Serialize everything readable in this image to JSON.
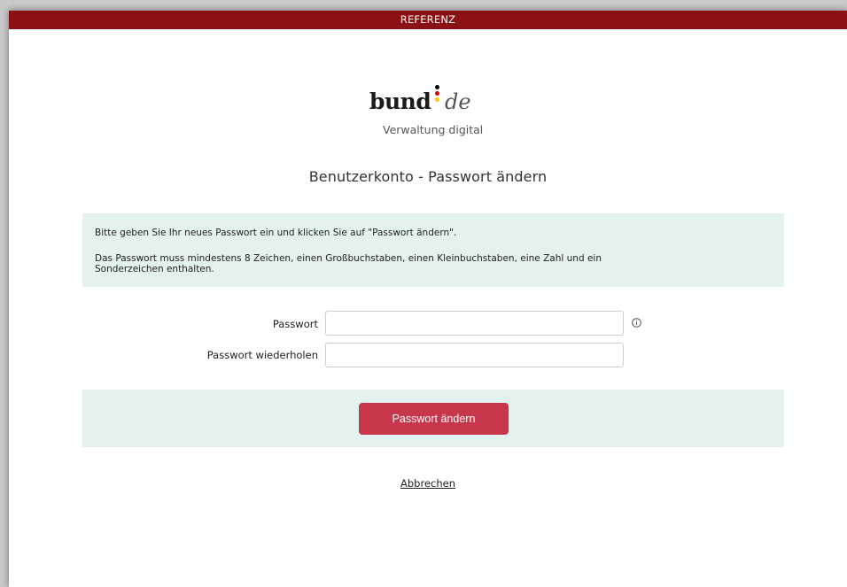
{
  "banner": {
    "label": "REFERENZ"
  },
  "logo": {
    "name_main": "bund",
    "name_suffix": "de",
    "tagline": "Verwaltung digital"
  },
  "page": {
    "title": "Benutzerkonto - Passwort ändern"
  },
  "info": {
    "line1": "Bitte geben Sie Ihr neues Passwort ein und klicken Sie auf \"Passwort ändern\".",
    "line2": "Das Passwort muss mindestens 8 Zeichen, einen Großbuchstaben, einen Kleinbuchstaben, eine Zahl und ein Sonderzeichen enthalten."
  },
  "form": {
    "password_label": "Passwort",
    "password_value": "",
    "password_repeat_label": "Passwort wiederholen",
    "password_repeat_value": ""
  },
  "actions": {
    "submit_label": "Passwort ändern",
    "cancel_label": "Abbrechen"
  },
  "colors": {
    "banner": "#8b1114",
    "panel": "#e4f2ef",
    "primary_button": "#c7364a",
    "flag_black": "#000000",
    "flag_red": "#dd0000",
    "flag_gold": "#ffcc00"
  },
  "icons": {
    "password_hint": "info-circle-icon"
  }
}
